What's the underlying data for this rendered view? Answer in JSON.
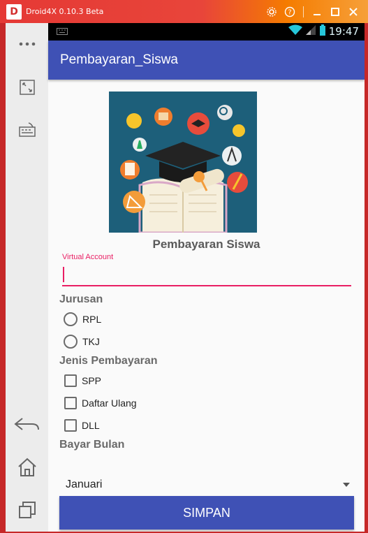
{
  "emulator": {
    "title": "Droid4X 0.10.3 Beta",
    "logo_letter": "D",
    "controls": [
      "gear-icon",
      "help-icon",
      "minimize-icon",
      "maximize-icon",
      "close-icon"
    ]
  },
  "status_bar": {
    "time": "19:47"
  },
  "app_bar": {
    "title": "Pembayaran_Siswa"
  },
  "form": {
    "heading": "Pembayaran Siswa",
    "virtual_account": {
      "label": "Virtual Account",
      "value": ""
    },
    "jurusan": {
      "label": "Jurusan",
      "options": [
        "RPL",
        "TKJ"
      ]
    },
    "jenis_pembayaran": {
      "label": "Jenis Pembayaran",
      "options": [
        "SPP",
        "Daftar Ulang",
        "DLL"
      ]
    },
    "bayar_bulan": {
      "label": "Bayar Bulan",
      "selected": "Januari"
    },
    "submit_label": "SIMPAN"
  },
  "colors": {
    "primary": "#3f51b5",
    "accent": "#e91e63",
    "emulator_red": "#d32f2f",
    "hero_bg": "#1d5f7a"
  }
}
